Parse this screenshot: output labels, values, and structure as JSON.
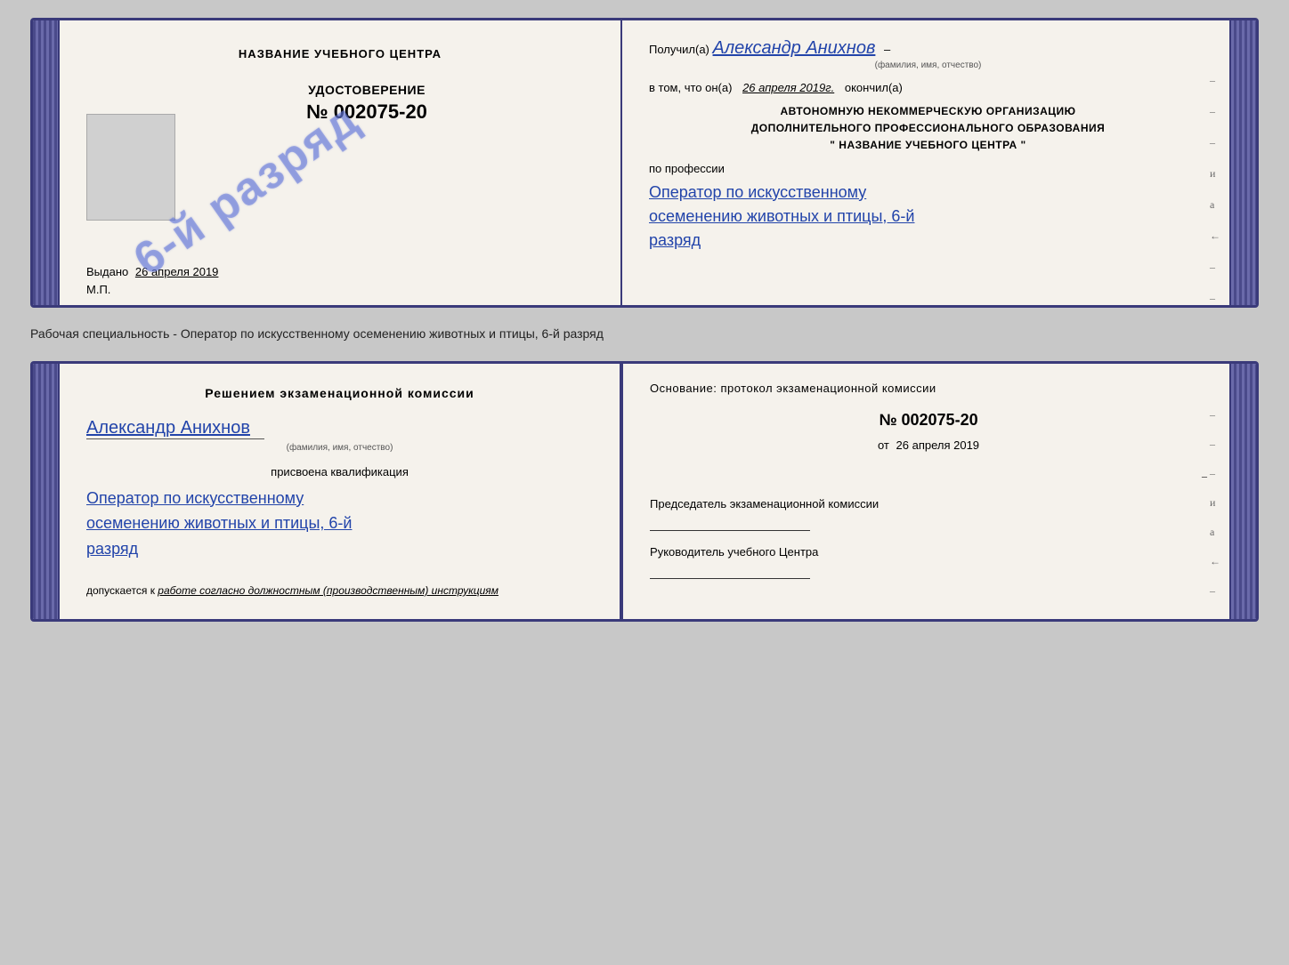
{
  "top_card": {
    "left": {
      "center_title": "НАЗВАНИЕ УЧЕБНОГО ЦЕНТРА",
      "udostoverenie_label": "УДОСТОВЕРЕНИЕ",
      "doc_number": "№ 002075-20",
      "vydano_label": "Выдано",
      "vydano_date": "26 апреля 2019",
      "mp_label": "М.П.",
      "stamp_text": "6-й разряд"
    },
    "right": {
      "poluchil_prefix": "Получил(а)",
      "recipient_name": "Александр Анихнов",
      "name_subtitle": "(фамилия, имя, отчество)",
      "vtom_prefix": "в том, что он(а)",
      "date_italic": "26 апреля 2019г.",
      "okончил_suffix": "окончил(а)",
      "org_line1": "АВТОНОМНУЮ НЕКОММЕРЧЕСКУЮ ОРГАНИЗАЦИЮ",
      "org_line2": "ДОПОЛНИТЕЛЬНОГО ПРОФЕССИОНАЛЬНОГО ОБРАЗОВАНИЯ",
      "org_line3": "\"   НАЗВАНИЕ УЧЕБНОГО ЦЕНТРА   \"",
      "po_professii": "по профессии",
      "profession_line1": "Оператор по искусственному",
      "profession_line2": "осеменению животных и птицы, 6-й",
      "profession_line3": "разряд"
    }
  },
  "between_label": {
    "text": "Рабочая специальность - Оператор по искусственному осеменению животных и птицы, 6-й разряд"
  },
  "bottom_card": {
    "left": {
      "reshenie_title": "Решением экзаменационной комиссии",
      "person_name": "Александр Анихнов",
      "name_subtitle": "(фамилия, имя, отчество)",
      "prisvoena": "присвоена квалификация",
      "profession_line1": "Оператор по искусственному",
      "profession_line2": "осеменению животных и птицы, 6-й",
      "profession_line3": "разряд",
      "допускается_label": "допускается к",
      "допускается_text": "работе согласно должностным (производственным) инструкциям"
    },
    "right": {
      "osnov_label": "Основание: протокол экзаменационной комиссии",
      "protocol_number": "№  002075-20",
      "ot_prefix": "от",
      "ot_date": "26 апреля 2019",
      "predsedatel_label": "Председатель экзаменационной комиссии",
      "rukovoditel_label": "Руководитель учебного Центра"
    }
  },
  "right_side_dashes": [
    "-",
    "-",
    "-",
    "и",
    "а",
    "←",
    "-",
    "-"
  ]
}
